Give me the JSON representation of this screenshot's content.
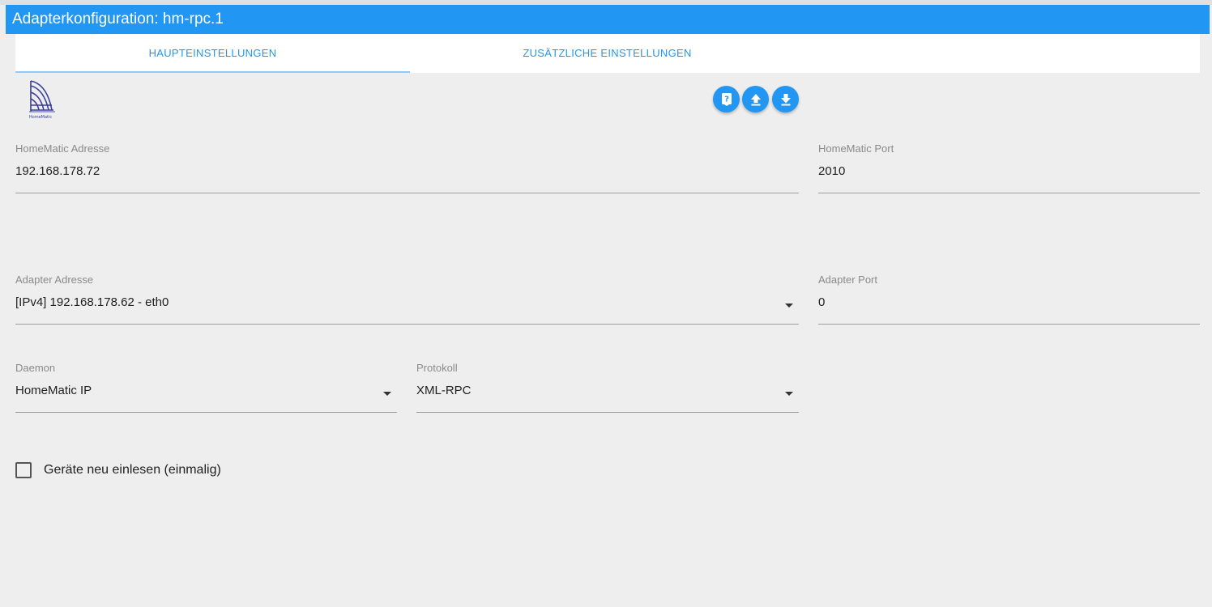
{
  "title": "Adapterkonfiguration: hm-rpc.1",
  "tabs": [
    {
      "label": "HAUPTEINSTELLUNGEN",
      "active": true
    },
    {
      "label": "ZUSÄTZLICHE EINSTELLUNGEN",
      "active": false
    }
  ],
  "logo": {
    "text": "HomeMatic"
  },
  "toolbar": {
    "icons": [
      "help-book-icon",
      "upload-icon",
      "download-icon"
    ]
  },
  "fields": {
    "homematic_address": {
      "label": "HomeMatic Adresse",
      "value": "192.168.178.72"
    },
    "homematic_port": {
      "label": "HomeMatic Port",
      "value": "2010"
    },
    "adapter_address": {
      "label": "Adapter Adresse",
      "value": "[IPv4] 192.168.178.62 - eth0"
    },
    "adapter_port": {
      "label": "Adapter Port",
      "value": "0"
    },
    "daemon": {
      "label": "Daemon",
      "value": "HomeMatic IP"
    },
    "protocol": {
      "label": "Protokoll",
      "value": "XML-RPC"
    }
  },
  "reread_devices": {
    "label": "Geräte neu einlesen (einmalig)",
    "checked": false
  },
  "colors": {
    "accent": "#2196f3",
    "background": "#eeeeee"
  }
}
